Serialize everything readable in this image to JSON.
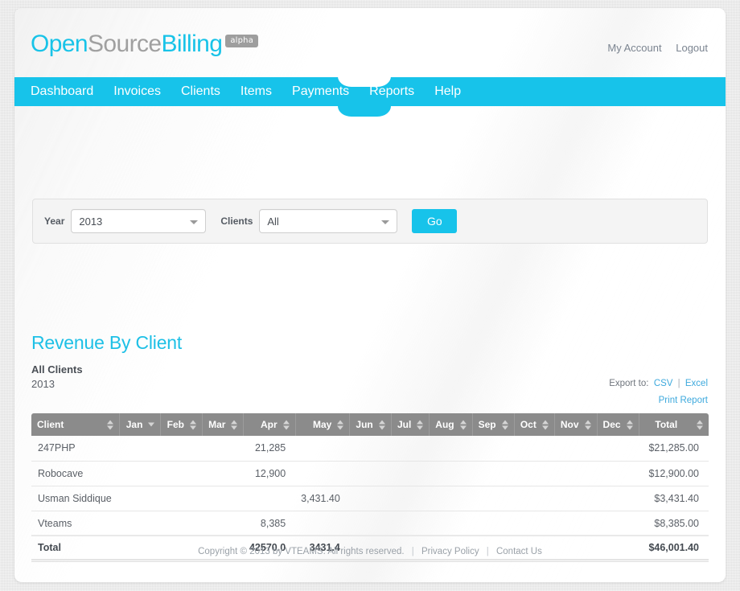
{
  "header": {
    "logo": {
      "part1": "Open",
      "part2": "Source",
      "part3": "Billing",
      "badge": "alpha"
    },
    "account_link": "My Account",
    "logout_link": "Logout"
  },
  "nav": {
    "items": [
      {
        "label": "Dashboard",
        "active": false
      },
      {
        "label": "Invoices",
        "active": false
      },
      {
        "label": "Clients",
        "active": false
      },
      {
        "label": "Items",
        "active": false
      },
      {
        "label": "Payments",
        "active": false
      },
      {
        "label": "Reports",
        "active": true
      },
      {
        "label": "Help",
        "active": false
      }
    ],
    "active_item": "Reports",
    "bg_color": "#17c3ea"
  },
  "filter_bar": {
    "year_label": "Year",
    "year_value": "2013",
    "clients_label": "Clients",
    "clients_value": "All",
    "go_label": "Go"
  },
  "report": {
    "title": "Revenue By Client",
    "subtitle_clients": "All Clients",
    "subtitle_year": "2013",
    "export_label": "Export to:",
    "export_csv": "CSV",
    "export_sep": "|",
    "export_excel": "Excel",
    "print_label": "Print Report"
  },
  "chart_data": {
    "type": "table",
    "title": "Revenue By Client",
    "subtitle": "All Clients 2013",
    "columns": [
      {
        "key": "client",
        "label": "Client",
        "align": "left",
        "sorted": false
      },
      {
        "key": "jan",
        "label": "Jan",
        "align": "right",
        "sorted": true
      },
      {
        "key": "feb",
        "label": "Feb",
        "align": "right",
        "sorted": false
      },
      {
        "key": "mar",
        "label": "Mar",
        "align": "right",
        "sorted": false
      },
      {
        "key": "apr",
        "label": "Apr",
        "align": "right",
        "sorted": false
      },
      {
        "key": "may",
        "label": "May",
        "align": "right",
        "sorted": false
      },
      {
        "key": "jun",
        "label": "Jun",
        "align": "right",
        "sorted": false
      },
      {
        "key": "jul",
        "label": "Jul",
        "align": "right",
        "sorted": false
      },
      {
        "key": "aug",
        "label": "Aug",
        "align": "right",
        "sorted": false
      },
      {
        "key": "sep",
        "label": "Sep",
        "align": "right",
        "sorted": false
      },
      {
        "key": "oct",
        "label": "Oct",
        "align": "right",
        "sorted": false
      },
      {
        "key": "nov",
        "label": "Nov",
        "align": "right",
        "sorted": false
      },
      {
        "key": "dec",
        "label": "Dec",
        "align": "right",
        "sorted": false
      },
      {
        "key": "total",
        "label": "Total",
        "align": "right",
        "sorted": false
      }
    ],
    "rows": [
      {
        "client": "247PHP",
        "jan": "",
        "feb": "",
        "mar": "",
        "apr": "21,285",
        "may": "",
        "jun": "",
        "jul": "",
        "aug": "",
        "sep": "",
        "oct": "",
        "nov": "",
        "dec": "",
        "total": "$21,285.00"
      },
      {
        "client": "Robocave",
        "jan": "",
        "feb": "",
        "mar": "",
        "apr": "12,900",
        "may": "",
        "jun": "",
        "jul": "",
        "aug": "",
        "sep": "",
        "oct": "",
        "nov": "",
        "dec": "",
        "total": "$12,900.00"
      },
      {
        "client": "Usman Siddique",
        "jan": "",
        "feb": "",
        "mar": "",
        "apr": "",
        "may": "3,431.40",
        "jun": "",
        "jul": "",
        "aug": "",
        "sep": "",
        "oct": "",
        "nov": "",
        "dec": "",
        "total": "$3,431.40"
      },
      {
        "client": "Vteams",
        "jan": "",
        "feb": "",
        "mar": "",
        "apr": "8,385",
        "may": "",
        "jun": "",
        "jul": "",
        "aug": "",
        "sep": "",
        "oct": "",
        "nov": "",
        "dec": "",
        "total": "$8,385.00"
      }
    ],
    "total_row": {
      "client": "Total",
      "jan": "",
      "feb": "",
      "mar": "",
      "apr": "42570.0",
      "may": "3431.4",
      "jun": "",
      "jul": "",
      "aug": "",
      "sep": "",
      "oct": "",
      "nov": "",
      "dec": "",
      "total": "$46,001.40"
    }
  },
  "footer": {
    "copyright": "Copyright © 2013 by VTEAMS. All rights reserved.",
    "sep1": "|",
    "privacy": "Privacy Policy",
    "sep2": "|",
    "contact": "Contact Us"
  }
}
